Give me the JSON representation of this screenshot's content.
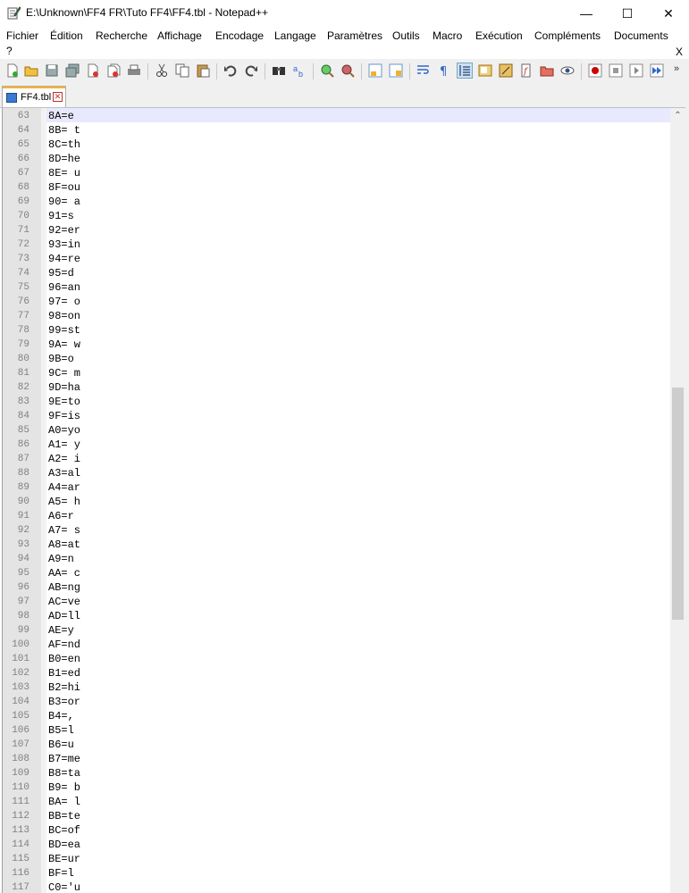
{
  "window": {
    "title": "E:\\Unknown\\FF4 FR\\Tuto FF4\\FF4.tbl - Notepad++",
    "minimize_glyph": "—",
    "maximize_glyph": "☐",
    "close_glyph": "✕"
  },
  "menu": {
    "items": [
      "Fichier",
      "Édition",
      "Recherche",
      "Affichage",
      "Encodage",
      "Langage",
      "Paramètres",
      "Outils",
      "Macro",
      "Exécution",
      "Compléments",
      "Documents"
    ],
    "help": "?",
    "close_doc": "X"
  },
  "toolbar": {
    "icons": [
      "new-file-icon",
      "open-file-icon",
      "save-icon",
      "save-all-icon",
      "close-icon",
      "close-all-icon",
      "print-icon",
      "cut-icon",
      "copy-icon",
      "paste-icon",
      "undo-icon",
      "redo-icon",
      "find-icon",
      "replace-icon",
      "zoom-in-icon",
      "zoom-out-icon",
      "sync-vertical-icon",
      "sync-horizontal-icon",
      "word-wrap-icon",
      "show-all-characters-icon",
      "indent-guide-icon",
      "document-map-icon",
      "function-list-icon",
      "folder-as-workspace-icon",
      "monitoring-icon",
      "doc-switcher-icon",
      "record-macro-icon",
      "stop-record-icon",
      "playback-icon",
      "run-macro-multiple-icon"
    ]
  },
  "tab": {
    "label": "FF4.tbl",
    "close_glyph": "✕",
    "accent": "#fab428"
  },
  "editor": {
    "current_line_color": "#e8e8ff",
    "lines": [
      {
        "n": "63",
        "t": "8A=e"
      },
      {
        "n": "64",
        "t": "8B= t"
      },
      {
        "n": "65",
        "t": "8C=th"
      },
      {
        "n": "66",
        "t": "8D=he"
      },
      {
        "n": "67",
        "t": "8E= u"
      },
      {
        "n": "68",
        "t": "8F=ou"
      },
      {
        "n": "69",
        "t": "90= a"
      },
      {
        "n": "70",
        "t": "91=s"
      },
      {
        "n": "71",
        "t": "92=er"
      },
      {
        "n": "72",
        "t": "93=in"
      },
      {
        "n": "73",
        "t": "94=re"
      },
      {
        "n": "74",
        "t": "95=d"
      },
      {
        "n": "75",
        "t": "96=an"
      },
      {
        "n": "76",
        "t": "97= o"
      },
      {
        "n": "77",
        "t": "98=on"
      },
      {
        "n": "78",
        "t": "99=st"
      },
      {
        "n": "79",
        "t": "9A= w"
      },
      {
        "n": "80",
        "t": "9B=o"
      },
      {
        "n": "81",
        "t": "9C= m"
      },
      {
        "n": "82",
        "t": "9D=ha"
      },
      {
        "n": "83",
        "t": "9E=to"
      },
      {
        "n": "84",
        "t": "9F=is"
      },
      {
        "n": "85",
        "t": "A0=yo"
      },
      {
        "n": "86",
        "t": "A1= y"
      },
      {
        "n": "87",
        "t": "A2= i"
      },
      {
        "n": "88",
        "t": "A3=al"
      },
      {
        "n": "89",
        "t": "A4=ar"
      },
      {
        "n": "90",
        "t": "A5= h"
      },
      {
        "n": "91",
        "t": "A6=r"
      },
      {
        "n": "92",
        "t": "A7= s"
      },
      {
        "n": "93",
        "t": "A8=at"
      },
      {
        "n": "94",
        "t": "A9=n"
      },
      {
        "n": "95",
        "t": "AA= c"
      },
      {
        "n": "96",
        "t": "AB=ng"
      },
      {
        "n": "97",
        "t": "AC=ve"
      },
      {
        "n": "98",
        "t": "AD=ll"
      },
      {
        "n": "99",
        "t": "AE=y"
      },
      {
        "n": "100",
        "t": "AF=nd"
      },
      {
        "n": "101",
        "t": "B0=en"
      },
      {
        "n": "102",
        "t": "B1=ed"
      },
      {
        "n": "103",
        "t": "B2=hi"
      },
      {
        "n": "104",
        "t": "B3=or"
      },
      {
        "n": "105",
        "t": "B4=,"
      },
      {
        "n": "106",
        "t": "B5=l"
      },
      {
        "n": "107",
        "t": "B6=u"
      },
      {
        "n": "108",
        "t": "B7=me"
      },
      {
        "n": "109",
        "t": "B8=ta"
      },
      {
        "n": "110",
        "t": "B9= b"
      },
      {
        "n": "111",
        "t": "BA= l"
      },
      {
        "n": "112",
        "t": "BB=te"
      },
      {
        "n": "113",
        "t": "BC=of"
      },
      {
        "n": "114",
        "t": "BD=ea"
      },
      {
        "n": "115",
        "t": "BE=ur"
      },
      {
        "n": "116",
        "t": "BF=l"
      },
      {
        "n": "117",
        "t": "C0='u"
      }
    ]
  },
  "scrollbar": {
    "up_glyph": "⌃"
  }
}
